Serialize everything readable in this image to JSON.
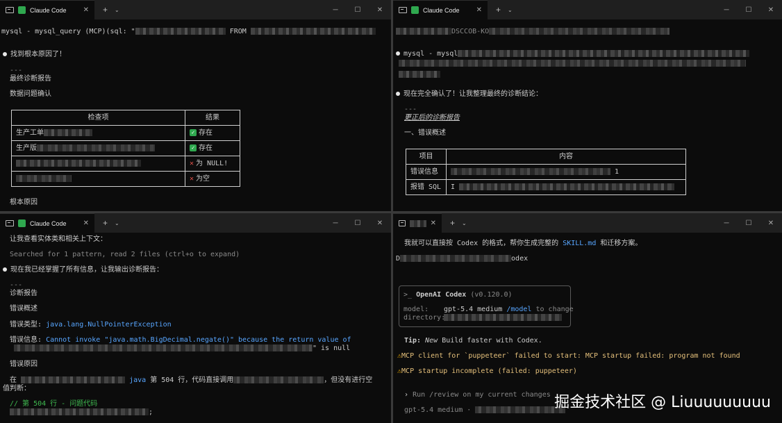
{
  "tabs": {
    "claude_title": "Claude Code",
    "new_tab": "+",
    "dropdown": "⌄",
    "close": "✕",
    "minimize": "─",
    "maximize": "☐"
  },
  "pane1": {
    "line_mcp": "mysql - mysql_query (MCP)(sql: \"",
    "line_mcp_end": "FROM",
    "found": "找到根本原因了！",
    "sep": "---",
    "report_title": "最终诊断报告",
    "section_confirm": "数据问题确认",
    "table_headers": [
      "检查项",
      "结果"
    ],
    "rows": [
      {
        "item": "生产工单",
        "result": "存在"
      },
      {
        "item": "生产版",
        "result": "存在"
      },
      {
        "item": "",
        "result": "为 NULL!"
      },
      {
        "item": "",
        "result": "为空"
      }
    ],
    "root_cause": "根本原因"
  },
  "pane2": {
    "line_top": "DSCCOB-KO",
    "line_mcp": "mysql - mysql",
    "confirmed": "现在完全确认了！让我整理最终的诊断结论：",
    "sep": "---",
    "corrected_title": "更正后的诊断报告",
    "section_overview": "一、错误概述",
    "table_headers": [
      "项目",
      "内容"
    ],
    "rows": [
      {
        "item": "错误信息",
        "value": "1"
      },
      {
        "item": "报错 SQL",
        "value": "I"
      }
    ]
  },
  "pane3": {
    "check_entity": "让我查看实体类和相关上下文：",
    "searched": "Searched for 1 pattern, read 2 files (ctrl+o to expand)",
    "have_all": "现在我已经掌握了所有信息，让我输出诊断报告：",
    "sep": "---",
    "report": "诊断报告",
    "overview": "错误概述",
    "err_type_label": "错误类型:",
    "err_type_value": "java.lang.NullPointerException",
    "err_msg_label": "错误信息:",
    "err_msg_value": "Cannot invoke \"java.math.BigDecimal.negate()\" because the return value of",
    "err_msg_tail": "\" is null",
    "cause_title": "错误原因",
    "cause_text_a": "在",
    "cause_text_java": "java",
    "cause_text_b": "第 504 行，代码直接调用",
    "cause_text_c": "，但没有进行空",
    "cause_text_d": "值判断：",
    "code_comment": "// 第 504 行 - 问题代码",
    "code_end": ";"
  },
  "pane4": {
    "intro_a": "我就可以直接按 Codex 的格式，帮你生成完整的",
    "intro_skill": "SKILL.md",
    "intro_b": "和迁移方案。",
    "line_d": "D",
    "line_codex": "odex",
    "prompt": ">_",
    "codex_name": "OpenAI Codex",
    "codex_version": "(v0.120.0)",
    "model_label": "model:",
    "model_value": "gpt-5.4 medium",
    "model_cmd": "/model",
    "model_hint": "to change",
    "dir_label": "directory:",
    "tip_label": "Tip:",
    "tip_new": "New",
    "tip_text": "Build faster with Codex.",
    "warn_icon": "⚠",
    "warn1": "MCP client for `puppeteer` failed to start: MCP startup failed: program not found",
    "warn2": "MCP startup incomplete (failed: puppeteer)",
    "input_prompt": "›",
    "input_placeholder": "Run /review on my current changes",
    "status": "gpt-5.4 medium ·"
  },
  "watermark": "掘金技术社区 @ Liuuuuuuuuu"
}
